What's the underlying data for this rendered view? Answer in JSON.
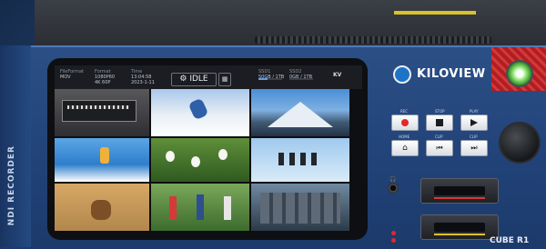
{
  "device": {
    "side_label": "NDI RECORDER",
    "brand": "KILOVIEW",
    "model": "CUBE R1"
  },
  "status_bar": {
    "file_format_label": "FileFormat",
    "file_format_value": "MOV",
    "format_label": "Format",
    "format_value": "1080P60",
    "format_sub": "4K 60P",
    "time_label": "Time",
    "time_value": "13:04:58",
    "time_sub": "2023-1-11",
    "state": "IDLE",
    "ssd1_label": "SSD1",
    "ssd1_value": "50GB / 1TB",
    "ssd2_label": "SSD2",
    "ssd2_value": "0GB / 1TB",
    "brand_short": "KV"
  },
  "controls": {
    "rec_label": "REC",
    "stop_label": "STOP",
    "play_label": "PLAY",
    "home_label": "HOME",
    "prev_label": "CLIP",
    "next_label": "CLIP"
  },
  "colors": {
    "panel": "#22447a",
    "accent_red": "#d3393a",
    "power_green": "#7fd861"
  }
}
